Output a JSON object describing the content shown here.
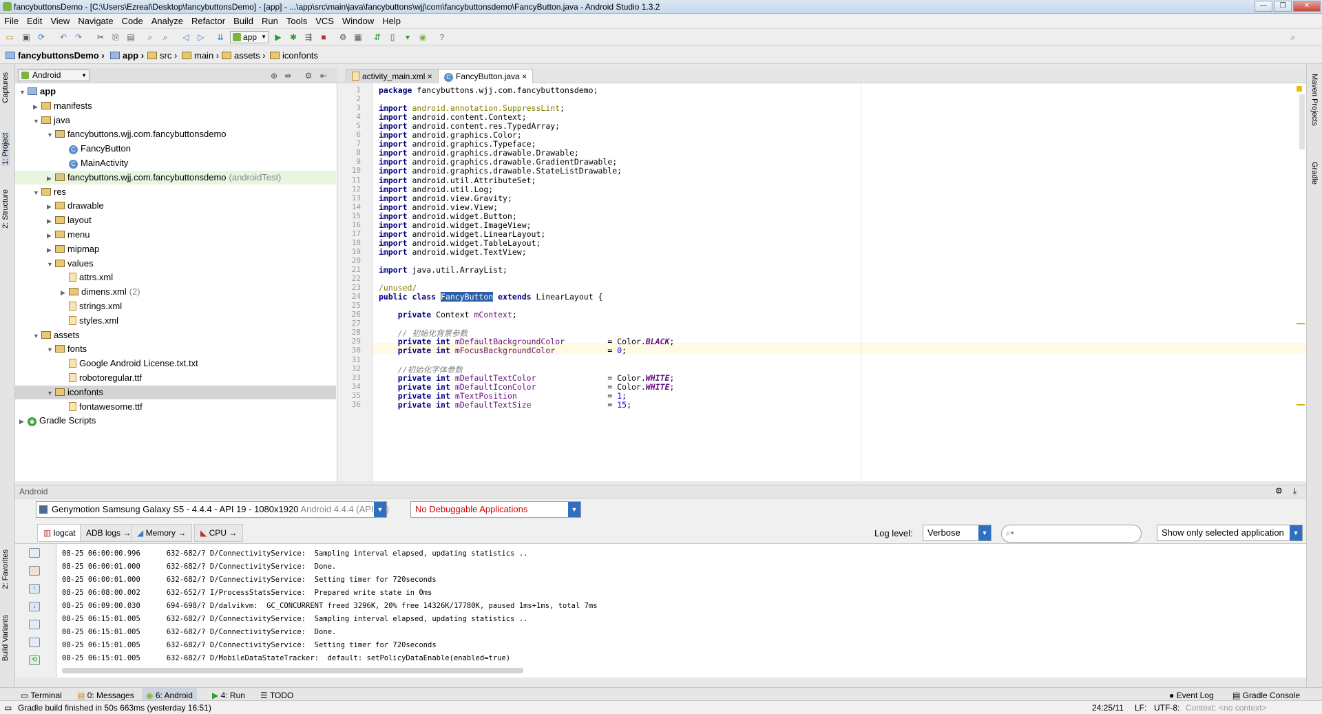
{
  "window": {
    "title": "fancybuttonsDemo - [C:\\Users\\Ezreal\\Desktop\\fancybuttonsDemo] - [app] - ...\\app\\src\\main\\java\\fancybuttons\\wjj\\com\\fancybuttonsdemo\\FancyButton.java - Android Studio 1.3.2",
    "min": "—",
    "max": "❐",
    "close": "✕"
  },
  "menu": [
    "File",
    "Edit",
    "View",
    "Navigate",
    "Code",
    "Analyze",
    "Refactor",
    "Build",
    "Run",
    "Tools",
    "VCS",
    "Window",
    "Help"
  ],
  "toolbar": {
    "run_config": "app"
  },
  "breadcrumb": [
    "fancybuttonsDemo",
    "app",
    "src",
    "main",
    "assets",
    "iconfonts"
  ],
  "left_strip": {
    "captures": "Captures",
    "project": "1: Project",
    "structure": "2: Structure",
    "favorites": "2: Favorites",
    "build_variants": "Build Variants"
  },
  "right_strip": {
    "maven": "Maven Projects",
    "gradle": "Gradle"
  },
  "project": {
    "view_mode": "Android",
    "tree": [
      {
        "label": "app",
        "level": 0,
        "icon": "module",
        "open": true
      },
      {
        "label": "manifests",
        "level": 1,
        "icon": "folder",
        "open": false
      },
      {
        "label": "java",
        "level": 1,
        "icon": "folder",
        "open": true
      },
      {
        "label": "fancybuttons.wjj.com.fancybuttonsdemo",
        "level": 2,
        "icon": "package",
        "open": true
      },
      {
        "label": "FancyButton",
        "level": 3,
        "icon": "class"
      },
      {
        "label": "MainActivity",
        "level": 3,
        "icon": "class"
      },
      {
        "label": "fancybuttons.wjj.com.fancybuttonsdemo",
        "suffix": "(androidTest)",
        "level": 2,
        "icon": "package",
        "open": false
      },
      {
        "label": "res",
        "level": 1,
        "icon": "folder",
        "open": true
      },
      {
        "label": "drawable",
        "level": 2,
        "icon": "folder",
        "open": false
      },
      {
        "label": "layout",
        "level": 2,
        "icon": "folder",
        "open": false
      },
      {
        "label": "menu",
        "level": 2,
        "icon": "folder",
        "open": false
      },
      {
        "label": "mipmap",
        "level": 2,
        "icon": "folder",
        "open": false
      },
      {
        "label": "values",
        "level": 2,
        "icon": "folder",
        "open": true
      },
      {
        "label": "attrs.xml",
        "level": 3,
        "icon": "xml"
      },
      {
        "label": "dimens.xml",
        "suffix": "(2)",
        "level": 3,
        "icon": "folder",
        "open": false
      },
      {
        "label": "strings.xml",
        "level": 3,
        "icon": "xml"
      },
      {
        "label": "styles.xml",
        "level": 3,
        "icon": "xml"
      },
      {
        "label": "assets",
        "level": 1,
        "icon": "folder",
        "open": true
      },
      {
        "label": "fonts",
        "level": 2,
        "icon": "folder",
        "open": true
      },
      {
        "label": "Google Android License.txt.txt",
        "level": 3,
        "icon": "file"
      },
      {
        "label": "robotoregular.ttf",
        "level": 3,
        "icon": "file"
      },
      {
        "label": "iconfonts",
        "level": 2,
        "icon": "folder",
        "open": true,
        "selected": true
      },
      {
        "label": "fontawesome.ttf",
        "level": 3,
        "icon": "file"
      },
      {
        "label": "Gradle Scripts",
        "level": 0,
        "icon": "gradle",
        "open": false
      }
    ]
  },
  "editor_tabs": [
    {
      "label": "activity_main.xml",
      "active": false
    },
    {
      "label": "FancyButton.java",
      "active": true
    }
  ],
  "code": [
    {
      "n": "1",
      "html": "<span class=\"kw\">package</span> fancybuttons.wjj.com.fancybuttonsdemo;"
    },
    {
      "n": "2",
      "html": ""
    },
    {
      "n": "3",
      "html": "<span class=\"kw\">import</span> <span class=\"ann\">android.annotation.SuppressLint</span>;"
    },
    {
      "n": "4",
      "html": "<span class=\"kw\">import</span> android.content.Context;"
    },
    {
      "n": "5",
      "html": "<span class=\"kw\">import</span> android.content.res.TypedArray;"
    },
    {
      "n": "6",
      "html": "<span class=\"kw\">import</span> android.graphics.Color;"
    },
    {
      "n": "7",
      "html": "<span class=\"kw\">import</span> android.graphics.Typeface;"
    },
    {
      "n": "8",
      "html": "<span class=\"kw\">import</span> android.graphics.drawable.Drawable;"
    },
    {
      "n": "9",
      "html": "<span class=\"kw\">import</span> android.graphics.drawable.GradientDrawable;"
    },
    {
      "n": "10",
      "html": "<span class=\"kw\">import</span> android.graphics.drawable.StateListDrawable;"
    },
    {
      "n": "11",
      "html": "<span class=\"kw\">import</span> android.util.AttributeSet;"
    },
    {
      "n": "12",
      "html": "<span class=\"kw\">import</span> android.util.Log;"
    },
    {
      "n": "13",
      "html": "<span class=\"kw\">import</span> android.view.Gravity;"
    },
    {
      "n": "14",
      "html": "<span class=\"kw\">import</span> android.view.View;"
    },
    {
      "n": "15",
      "html": "<span class=\"kw\">import</span> android.widget.Button;"
    },
    {
      "n": "16",
      "html": "<span class=\"kw\">import</span> android.widget.ImageView;"
    },
    {
      "n": "17",
      "html": "<span class=\"kw\">import</span> android.widget.LinearLayout;"
    },
    {
      "n": "18",
      "html": "<span class=\"kw\">import</span> android.widget.TableLayout;"
    },
    {
      "n": "19",
      "html": "<span class=\"kw\">import</span> android.widget.TextView;"
    },
    {
      "n": "20",
      "html": ""
    },
    {
      "n": "21",
      "html": "<span class=\"kw\">import</span> java.util.ArrayList;"
    },
    {
      "n": "22",
      "html": ""
    },
    {
      "n": "23",
      "html": "<span class=\"ann\">/unused/</span>"
    },
    {
      "n": "24",
      "html": "<span class=\"kw\">public class</span> <span class=\"hl\">FancyButton</span> <span class=\"kw\">extends</span> LinearLayout {"
    },
    {
      "n": "25",
      "html": ""
    },
    {
      "n": "26",
      "html": "    <span class=\"kw\">private</span> Context <span class=\"fld\">mContext</span>;"
    },
    {
      "n": "27",
      "html": ""
    },
    {
      "n": "28",
      "html": "    <span class=\"cm\">// 初始化背景参数</span>"
    },
    {
      "n": "29",
      "html": "    <span class=\"kw\">private int</span> <span class=\"fld\">mDefaultBackgroundColor</span>         = Color.<span class=\"stat\">BLACK</span>;"
    },
    {
      "n": "30",
      "html": "    <span class=\"kw\">private int</span> <span class=\"fld\">mFocusBackgroundColor</span>           = <span class=\"num\">0</span>;"
    },
    {
      "n": "31",
      "html": ""
    },
    {
      "n": "32",
      "html": "    <span class=\"cm\">//初始化字体参数</span>"
    },
    {
      "n": "33",
      "html": "    <span class=\"kw\">private int</span> <span class=\"fld\">mDefaultTextColor</span>               = Color.<span class=\"stat\">WHITE</span>;"
    },
    {
      "n": "34",
      "html": "    <span class=\"kw\">private int</span> <span class=\"fld\">mDefaultIconColor</span>               = Color.<span class=\"stat\">WHITE</span>;"
    },
    {
      "n": "35",
      "html": "    <span class=\"kw\">private int</span> <span class=\"fld\">mTextPosition</span>                   = <span class=\"num\">1</span>;"
    },
    {
      "n": "36",
      "html": "    <span class=\"kw\">private int</span> <span class=\"fld\">mDefaultTextSize</span>                = <span class=\"num\">15</span>;"
    }
  ],
  "android_panel": {
    "title": "Android",
    "device": "Genymotion Samsung Galaxy S5 - 4.4.4 - API 19 - 1080x1920",
    "device_suffix": "Android 4.4.4 (API 19)",
    "app_select": "No Debuggable Applications",
    "tabs": [
      "logcat",
      "ADB logs",
      "Memory",
      "CPU"
    ],
    "log_level_label": "Log level:",
    "log_level": "Verbose",
    "search_placeholder": "",
    "filter": "Show only selected application",
    "log": [
      "08-25 06:00:00.996      632-682/? D/ConnectivityService:  Sampling interval elapsed, updating statistics ..",
      "08-25 06:00:01.000      632-682/? D/ConnectivityService:  Done.",
      "08-25 06:00:01.000      632-682/? D/ConnectivityService:  Setting timer for 720seconds",
      "08-25 06:08:00.002      632-652/? I/ProcessStatsService:  Prepared write state in 0ms",
      "08-25 06:09:00.030      694-698/? D/dalvikvm:  GC_CONCURRENT freed 3296K, 20% free 14326K/17780K, paused 1ms+1ms, total 7ms",
      "08-25 06:15:01.005      632-682/? D/ConnectivityService:  Sampling interval elapsed, updating statistics ..",
      "08-25 06:15:01.005      632-682/? D/ConnectivityService:  Done.",
      "08-25 06:15:01.005      632-682/? D/ConnectivityService:  Setting timer for 720seconds",
      "08-25 06:15:01.005      632-682/? D/MobileDataStateTracker:  default: setPolicyDataEnable(enabled=true)"
    ]
  },
  "bottom_tabs": {
    "terminal": "Terminal",
    "messages": "0: Messages",
    "android": "6: Android",
    "run": "4: Run",
    "todo": "TODO",
    "event_log": "Event Log",
    "gradle_console": "Gradle Console"
  },
  "status": {
    "message": "Gradle build finished in 50s 663ms (yesterday 16:51)",
    "position": "24:25/11",
    "line_sep": "LF:",
    "encoding": "UTF-8:",
    "context": "Context: <no context>"
  },
  "colors": {
    "accent": "#2f6fc2",
    "selection": "#2b5fa8",
    "current_line": "#fffae3",
    "app_select_text": "#cc0000"
  }
}
